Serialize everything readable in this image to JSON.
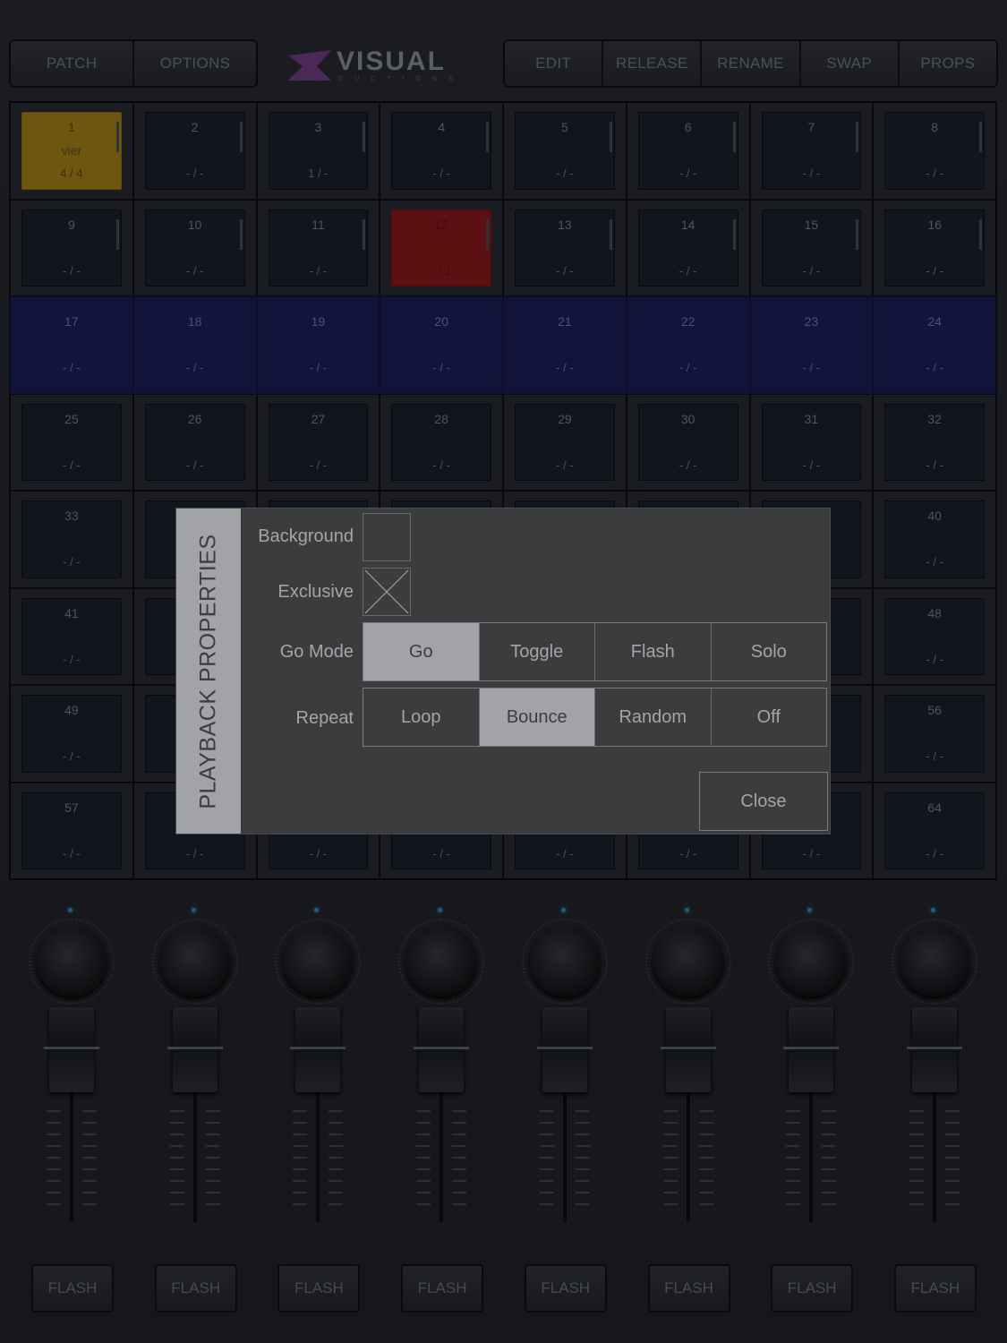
{
  "toolbar": {
    "left": [
      {
        "label": "PATCH"
      },
      {
        "label": "OPTIONS"
      }
    ],
    "right": [
      {
        "label": "EDIT"
      },
      {
        "label": "RELEASE"
      },
      {
        "label": "RENAME"
      },
      {
        "label": "SWAP"
      },
      {
        "label": "PROPS"
      }
    ]
  },
  "logo": {
    "word": "VISUAL",
    "sub": "PRODUCTIONS"
  },
  "playbacks": [
    {
      "num": "1",
      "name": "vier",
      "state": "4 / 4",
      "color": "yellow"
    },
    {
      "num": "2",
      "state": "- / -"
    },
    {
      "num": "3",
      "state": "1 / -"
    },
    {
      "num": "4",
      "state": "- / -"
    },
    {
      "num": "5",
      "state": "- / -"
    },
    {
      "num": "6",
      "state": "- / -"
    },
    {
      "num": "7",
      "state": "- / -"
    },
    {
      "num": "8",
      "state": "- / -"
    },
    {
      "num": "9",
      "state": "- / -"
    },
    {
      "num": "10",
      "state": "- / -"
    },
    {
      "num": "11",
      "state": "- / -"
    },
    {
      "num": "12",
      "state": "- / 1",
      "color": "red"
    },
    {
      "num": "13",
      "state": "- / -"
    },
    {
      "num": "14",
      "state": "- / -"
    },
    {
      "num": "15",
      "state": "- / -"
    },
    {
      "num": "16",
      "state": "- / -"
    },
    {
      "num": "17",
      "state": "- / -"
    },
    {
      "num": "18",
      "state": "- / -"
    },
    {
      "num": "19",
      "state": "- / -"
    },
    {
      "num": "20",
      "state": "- / -"
    },
    {
      "num": "21",
      "state": "- / -"
    },
    {
      "num": "22",
      "state": "- / -"
    },
    {
      "num": "23",
      "state": "- / -"
    },
    {
      "num": "24",
      "state": "- / -"
    },
    {
      "num": "25",
      "state": "- / -"
    },
    {
      "num": "26",
      "state": "- / -"
    },
    {
      "num": "27",
      "state": "- / -"
    },
    {
      "num": "28",
      "state": "- / -"
    },
    {
      "num": "29",
      "state": "- / -"
    },
    {
      "num": "30",
      "state": "- / -"
    },
    {
      "num": "31",
      "state": "- / -"
    },
    {
      "num": "32",
      "state": "- / -"
    },
    {
      "num": "33",
      "state": "- / -"
    },
    {
      "num": "",
      "state": ""
    },
    {
      "num": "",
      "state": ""
    },
    {
      "num": "",
      "state": ""
    },
    {
      "num": "",
      "state": ""
    },
    {
      "num": "",
      "state": ""
    },
    {
      "num": "",
      "state": ""
    },
    {
      "num": "40",
      "state": "- / -"
    },
    {
      "num": "41",
      "state": "- / -"
    },
    {
      "num": "",
      "state": ""
    },
    {
      "num": "",
      "state": ""
    },
    {
      "num": "",
      "state": ""
    },
    {
      "num": "",
      "state": ""
    },
    {
      "num": "",
      "state": ""
    },
    {
      "num": "",
      "state": ""
    },
    {
      "num": "48",
      "state": "- / -"
    },
    {
      "num": "49",
      "state": "- / -"
    },
    {
      "num": "",
      "state": ""
    },
    {
      "num": "",
      "state": ""
    },
    {
      "num": "",
      "state": ""
    },
    {
      "num": "",
      "state": ""
    },
    {
      "num": "",
      "state": ""
    },
    {
      "num": "",
      "state": ""
    },
    {
      "num": "56",
      "state": "- / -"
    },
    {
      "num": "57",
      "state": "- / -"
    },
    {
      "num": "",
      "state": "- / -"
    },
    {
      "num": "",
      "state": "- / -"
    },
    {
      "num": "",
      "state": "- / -"
    },
    {
      "num": "",
      "state": "- / -"
    },
    {
      "num": "",
      "state": "- / -"
    },
    {
      "num": "",
      "state": "- / -"
    },
    {
      "num": "64",
      "state": "- / -"
    }
  ],
  "faders": [
    {
      "flash": "FLASH"
    },
    {
      "flash": "FLASH"
    },
    {
      "flash": "FLASH"
    },
    {
      "flash": "FLASH"
    },
    {
      "flash": "FLASH"
    },
    {
      "flash": "FLASH"
    },
    {
      "flash": "FLASH"
    },
    {
      "flash": "FLASH"
    }
  ],
  "dialog": {
    "title": "PLAYBACK PROPERTIES",
    "background_label": "Background",
    "background_checked": false,
    "exclusive_label": "Exclusive",
    "exclusive_checked": true,
    "go_mode_label": "Go Mode",
    "go_mode_options": [
      "Go",
      "Toggle",
      "Flash",
      "Solo"
    ],
    "go_mode_selected": "Go",
    "repeat_label": "Repeat",
    "repeat_options": [
      "Loop",
      "Bounce",
      "Random",
      "Off"
    ],
    "repeat_selected": "Bounce",
    "close_label": "Close"
  },
  "colors": {
    "pad_active_yellow": "#6e5510",
    "pad_active_red": "#5d1012",
    "row_band_blue": "#111338",
    "dialog_bg": "#3b3c3e"
  }
}
